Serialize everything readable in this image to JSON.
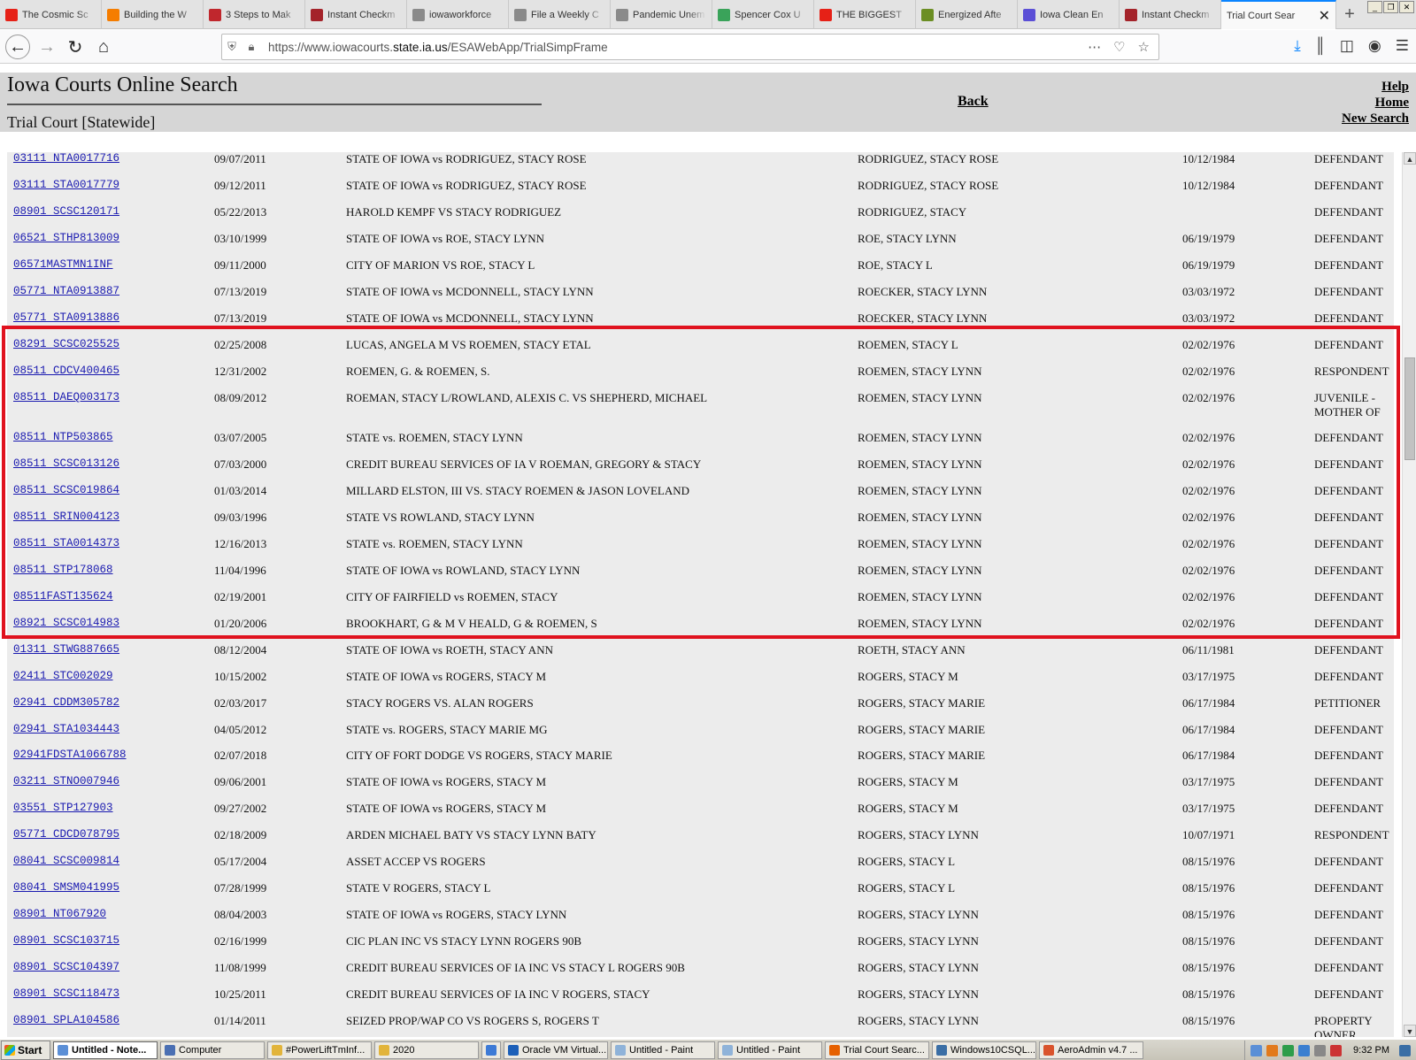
{
  "browser": {
    "tabs": [
      {
        "label": "The Cosmic Sc",
        "icon": "youtube-icon",
        "color": "#e62117"
      },
      {
        "label": "Building the W",
        "icon": "blogger-icon",
        "color": "#f57d00"
      },
      {
        "label": "3 Steps to Mak",
        "icon": "ed-icon",
        "color": "#c0272d"
      },
      {
        "label": "Instant Checkm",
        "icon": "instantcheckmate-icon",
        "color": "#a4232a"
      },
      {
        "label": "iowaworkforce",
        "icon": "wikipedia-icon",
        "color": "#8a8a8a"
      },
      {
        "label": "File a Weekly C",
        "icon": "wikipedia-icon",
        "color": "#8a8a8a"
      },
      {
        "label": "Pandemic Unem",
        "icon": "wikipedia-icon",
        "color": "#8a8a8a"
      },
      {
        "label": "Spencer Cox U",
        "icon": "checkmark-icon",
        "color": "#3aa35a"
      },
      {
        "label": "THE BIGGEST",
        "icon": "youtube-icon",
        "color": "#e62117"
      },
      {
        "label": "Energized Afte",
        "icon": "leaf-icon",
        "color": "#6b8e23"
      },
      {
        "label": "Iowa Clean En",
        "icon": "shield-icon",
        "color": "#5b4fd6"
      },
      {
        "label": "Instant Checkm",
        "icon": "instantcheckmate-icon",
        "color": "#a4232a"
      }
    ],
    "active_tab": {
      "label": "Trial Court Sear",
      "close": "✕"
    },
    "new_tab": "+",
    "window_controls": [
      "_",
      "❐",
      "✕"
    ],
    "url_prefix": "https://www.iowacourts.",
    "url_domain": "state.ia.us",
    "url_path": "/ESAWebApp/TrialSimpFrame"
  },
  "header": {
    "title": "Iowa Courts Online Search",
    "subtitle": "Trial Court [Statewide]",
    "back": "Back",
    "help": "Help",
    "home": "Home",
    "new_search": "New Search"
  },
  "rows": [
    {
      "case": "03111  NTA0017716",
      "date": "09/07/2011",
      "title": "STATE OF IOWA vs RODRIGUEZ, STACY ROSE",
      "name": "RODRIGUEZ, STACY ROSE",
      "dob": "10/12/1984",
      "role": "DEFENDANT"
    },
    {
      "case": "03111  STA0017779",
      "date": "09/12/2011",
      "title": "STATE OF IOWA vs RODRIGUEZ, STACY ROSE",
      "name": "RODRIGUEZ, STACY ROSE",
      "dob": "10/12/1984",
      "role": "DEFENDANT"
    },
    {
      "case": "08901  SCSC120171",
      "date": "05/22/2013",
      "title": "HAROLD KEMPF VS STACY RODRIGUEZ",
      "name": "RODRIGUEZ, STACY",
      "dob": "",
      "role": "DEFENDANT"
    },
    {
      "case": "06521  STHP813009",
      "date": "03/10/1999",
      "title": "STATE OF IOWA vs ROE, STACY LYNN",
      "name": "ROE, STACY LYNN",
      "dob": "06/19/1979",
      "role": "DEFENDANT"
    },
    {
      "case": "06571MASTMN1INF",
      "date": "09/11/2000",
      "title": "CITY OF MARION VS ROE, STACY L",
      "name": "ROE, STACY L",
      "dob": "06/19/1979",
      "role": "DEFENDANT"
    },
    {
      "case": "05771  NTA0913887",
      "date": "07/13/2019",
      "title": "STATE OF IOWA vs MCDONNELL, STACY LYNN",
      "name": "ROECKER, STACY LYNN",
      "dob": "03/03/1972",
      "role": "DEFENDANT"
    },
    {
      "case": "05771  STA0913886",
      "date": "07/13/2019",
      "title": "STATE OF IOWA vs MCDONNELL, STACY LYNN",
      "name": "ROECKER, STACY LYNN",
      "dob": "03/03/1972",
      "role": "DEFENDANT"
    },
    {
      "case": "08291  SCSC025525",
      "date": "02/25/2008",
      "title": "LUCAS, ANGELA M VS ROEMEN, STACY ETAL",
      "name": "ROEMEN, STACY L",
      "dob": "02/02/1976",
      "role": "DEFENDANT"
    },
    {
      "case": "08511  CDCV400465",
      "date": "12/31/2002",
      "title": "ROEMEN, G. & ROEMEN, S.",
      "name": "ROEMEN, STACY LYNN",
      "dob": "02/02/1976",
      "role": "RESPONDENT"
    },
    {
      "case": "08511  DAEQ003173",
      "date": "08/09/2012",
      "title": "ROEMAN, STACY L/ROWLAND, ALEXIS C. VS SHEPHERD, MICHAEL",
      "name": "ROEMEN, STACY LYNN",
      "dob": "02/02/1976",
      "role": "JUVENILE - MOTHER OF"
    },
    {
      "case": "08511  NTP503865",
      "date": "03/07/2005",
      "title": "STATE vs. ROEMEN, STACY LYNN",
      "name": "ROEMEN, STACY LYNN",
      "dob": "02/02/1976",
      "role": "DEFENDANT"
    },
    {
      "case": "08511  SCSC013126",
      "date": "07/03/2000",
      "title": "CREDIT BUREAU SERVICES OF IA V ROEMAN, GREGORY & STACY",
      "name": "ROEMEN, STACY LYNN",
      "dob": "02/02/1976",
      "role": "DEFENDANT"
    },
    {
      "case": "08511  SCSC019864",
      "date": "01/03/2014",
      "title": "MILLARD ELSTON, III VS. STACY ROEMEN & JASON LOVELAND",
      "name": "ROEMEN, STACY LYNN",
      "dob": "02/02/1976",
      "role": "DEFENDANT"
    },
    {
      "case": "08511  SRIN004123",
      "date": "09/03/1996",
      "title": "STATE VS ROWLAND, STACY LYNN",
      "name": "ROEMEN, STACY LYNN",
      "dob": "02/02/1976",
      "role": "DEFENDANT"
    },
    {
      "case": "08511  STA0014373",
      "date": "12/16/2013",
      "title": "STATE vs. ROEMEN, STACY LYNN",
      "name": "ROEMEN, STACY LYNN",
      "dob": "02/02/1976",
      "role": "DEFENDANT"
    },
    {
      "case": "08511  STP178068",
      "date": "11/04/1996",
      "title": "STATE OF IOWA vs ROWLAND, STACY LYNN",
      "name": "ROEMEN, STACY LYNN",
      "dob": "02/02/1976",
      "role": "DEFENDANT"
    },
    {
      "case": "08511FAST135624",
      "date": "02/19/2001",
      "title": "CITY OF FAIRFIELD vs ROEMEN, STACY",
      "name": "ROEMEN, STACY LYNN",
      "dob": "02/02/1976",
      "role": "DEFENDANT"
    },
    {
      "case": "08921  SCSC014983",
      "date": "01/20/2006",
      "title": "BROOKHART, G & M V HEALD, G & ROEMEN, S",
      "name": "ROEMEN, STACY LYNN",
      "dob": "02/02/1976",
      "role": "DEFENDANT"
    },
    {
      "case": "01311  STWG887665",
      "date": "08/12/2004",
      "title": "STATE OF IOWA vs ROETH, STACY ANN",
      "name": "ROETH, STACY ANN",
      "dob": "06/11/1981",
      "role": "DEFENDANT"
    },
    {
      "case": "02411  STC002029",
      "date": "10/15/2002",
      "title": "STATE OF IOWA vs ROGERS, STACY M",
      "name": "ROGERS, STACY M",
      "dob": "03/17/1975",
      "role": "DEFENDANT"
    },
    {
      "case": "02941  CDDM305782",
      "date": "02/03/2017",
      "title": "STACY ROGERS VS. ALAN ROGERS",
      "name": "ROGERS, STACY MARIE",
      "dob": "06/17/1984",
      "role": "PETITIONER"
    },
    {
      "case": "02941  STA1034443",
      "date": "04/05/2012",
      "title": "STATE vs. ROGERS, STACY MARIE MG",
      "name": "ROGERS, STACY MARIE",
      "dob": "06/17/1984",
      "role": "DEFENDANT"
    },
    {
      "case": "02941FDSTA1066788",
      "date": "02/07/2018",
      "title": "CITY OF FORT DODGE VS ROGERS, STACY MARIE",
      "name": "ROGERS, STACY MARIE",
      "dob": "06/17/1984",
      "role": "DEFENDANT"
    },
    {
      "case": "03211  STNO007946",
      "date": "09/06/2001",
      "title": "STATE OF IOWA vs ROGERS, STACY M",
      "name": "ROGERS, STACY M",
      "dob": "03/17/1975",
      "role": "DEFENDANT"
    },
    {
      "case": "03551  STP127903",
      "date": "09/27/2002",
      "title": "STATE OF IOWA vs ROGERS, STACY M",
      "name": "ROGERS, STACY M",
      "dob": "03/17/1975",
      "role": "DEFENDANT"
    },
    {
      "case": "05771  CDCD078795",
      "date": "02/18/2009",
      "title": "ARDEN MICHAEL BATY VS STACY LYNN BATY",
      "name": "ROGERS, STACY LYNN",
      "dob": "10/07/1971",
      "role": "RESPONDENT"
    },
    {
      "case": "08041  SCSC009814",
      "date": "05/17/2004",
      "title": "ASSET ACCEP VS ROGERS",
      "name": "ROGERS, STACY L",
      "dob": "08/15/1976",
      "role": "DEFENDANT"
    },
    {
      "case": "08041  SMSM041995",
      "date": "07/28/1999",
      "title": "STATE V ROGERS, STACY L",
      "name": "ROGERS, STACY L",
      "dob": "08/15/1976",
      "role": "DEFENDANT"
    },
    {
      "case": "08901  NT067920",
      "date": "08/04/2003",
      "title": "STATE OF IOWA vs ROGERS, STACY LYNN",
      "name": "ROGERS, STACY LYNN",
      "dob": "08/15/1976",
      "role": "DEFENDANT"
    },
    {
      "case": "08901  SCSC103715",
      "date": "02/16/1999",
      "title": "CIC PLAN INC VS STACY LYNN ROGERS 90B",
      "name": "ROGERS, STACY LYNN",
      "dob": "08/15/1976",
      "role": "DEFENDANT"
    },
    {
      "case": "08901  SCSC104397",
      "date": "11/08/1999",
      "title": "CREDIT BUREAU SERVICES OF IA INC VS STACY L ROGERS 90B",
      "name": "ROGERS, STACY LYNN",
      "dob": "08/15/1976",
      "role": "DEFENDANT"
    },
    {
      "case": "08901  SCSC118473",
      "date": "10/25/2011",
      "title": "CREDIT BUREAU SERVICES OF IA INC V ROGERS, STACY",
      "name": "ROGERS, STACY LYNN",
      "dob": "08/15/1976",
      "role": "DEFENDANT"
    },
    {
      "case": "08901  SPLA104586",
      "date": "01/14/2011",
      "title": "SEIZED PROP/WAP CO VS ROGERS S, ROGERS T",
      "name": "ROGERS, STACY LYNN",
      "dob": "08/15/1976",
      "role": "PROPERTY OWNER"
    }
  ],
  "taskbar": {
    "start": "Start",
    "items": [
      {
        "label": "Untitled - Note...",
        "active": true,
        "color": "#5b8fd6"
      },
      {
        "label": "Computer",
        "active": false,
        "color": "#4a6fb3"
      },
      {
        "label": "#PowerLiftTmInf...",
        "active": false,
        "color": "#e2b43a"
      },
      {
        "label": "2020",
        "active": false,
        "color": "#e2b43a"
      },
      {
        "label": "",
        "active": false,
        "color": "#3d7ad6"
      },
      {
        "label": "Oracle VM Virtual...",
        "active": false,
        "color": "#1c5fb8"
      },
      {
        "label": "Untitled - Paint",
        "active": false,
        "color": "#8fb3d9"
      },
      {
        "label": "Untitled - Paint",
        "active": false,
        "color": "#8fb3d9"
      },
      {
        "label": "Trial Court Searc...",
        "active": false,
        "color": "#e66000"
      },
      {
        "label": "Windows10CSQL...",
        "active": false,
        "color": "#3a6ea5"
      },
      {
        "label": "AeroAdmin v4.7 ...",
        "active": false,
        "color": "#d9532c"
      }
    ],
    "clock": "9:32 PM"
  }
}
